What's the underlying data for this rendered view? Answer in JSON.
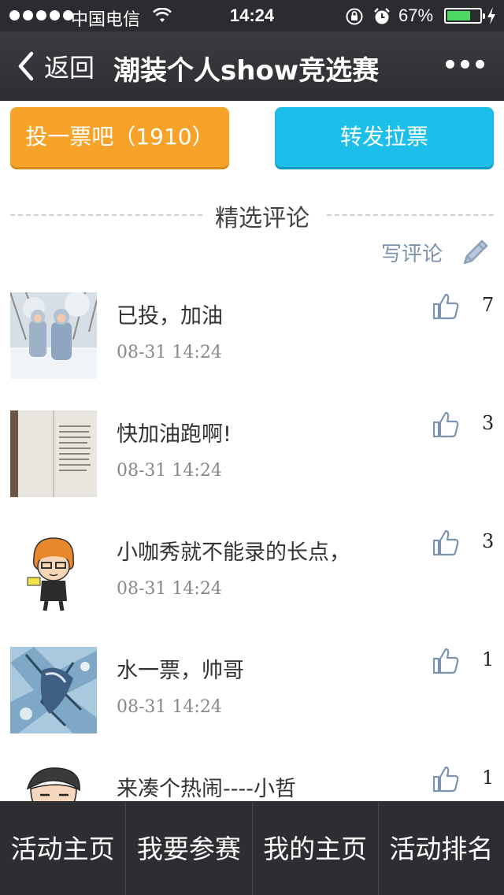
{
  "status_bar": {
    "carrier": "中国电信",
    "time": "14:24",
    "battery_percent_text": "67%",
    "battery_level": 0.67,
    "icons": [
      "signal-dots-icon",
      "wifi-icon",
      "rotation-lock-icon",
      "alarm-icon",
      "battery-icon",
      "charging-bolt-icon"
    ]
  },
  "navbar": {
    "back_label": "返回",
    "title": "潮装个人show竞选赛",
    "more_icon": "ellipsis-icon"
  },
  "actions": {
    "vote_label": "投一票吧（1910）",
    "share_label": "转发拉票",
    "vote_color": "#f7a329",
    "share_color": "#1bbfe9"
  },
  "section": {
    "title": "精选评论",
    "write_comment_label": "写评论",
    "write_icon": "pencil-icon"
  },
  "comments": [
    {
      "text": "已投，加油",
      "time": "08-31 14:24",
      "likes": "7",
      "avatar": "winter-children-photo"
    },
    {
      "text": "快加油跑啊!",
      "time": "08-31 14:24",
      "likes": "3",
      "avatar": "open-book-photo"
    },
    {
      "text": "小咖秀就不能录的长点，",
      "time": "08-31 14:24",
      "likes": "3",
      "avatar": "cartoon-boy-avatar"
    },
    {
      "text": "水一票，帅哥",
      "time": "08-31 14:24",
      "likes": "1",
      "avatar": "anime-art-avatar"
    },
    {
      "text": "来凑个热闹----小哲",
      "time": "",
      "likes": "1",
      "avatar": "cartoon-man-avatar"
    }
  ],
  "tabbar": {
    "tabs": [
      "活动主页",
      "我要参赛",
      "我的主页",
      "活动排名"
    ]
  },
  "colors": {
    "header_bg": "#2e2f33",
    "tabbar_bg": "#2d2e32",
    "accent_blue_gray": "#7d93ad"
  }
}
